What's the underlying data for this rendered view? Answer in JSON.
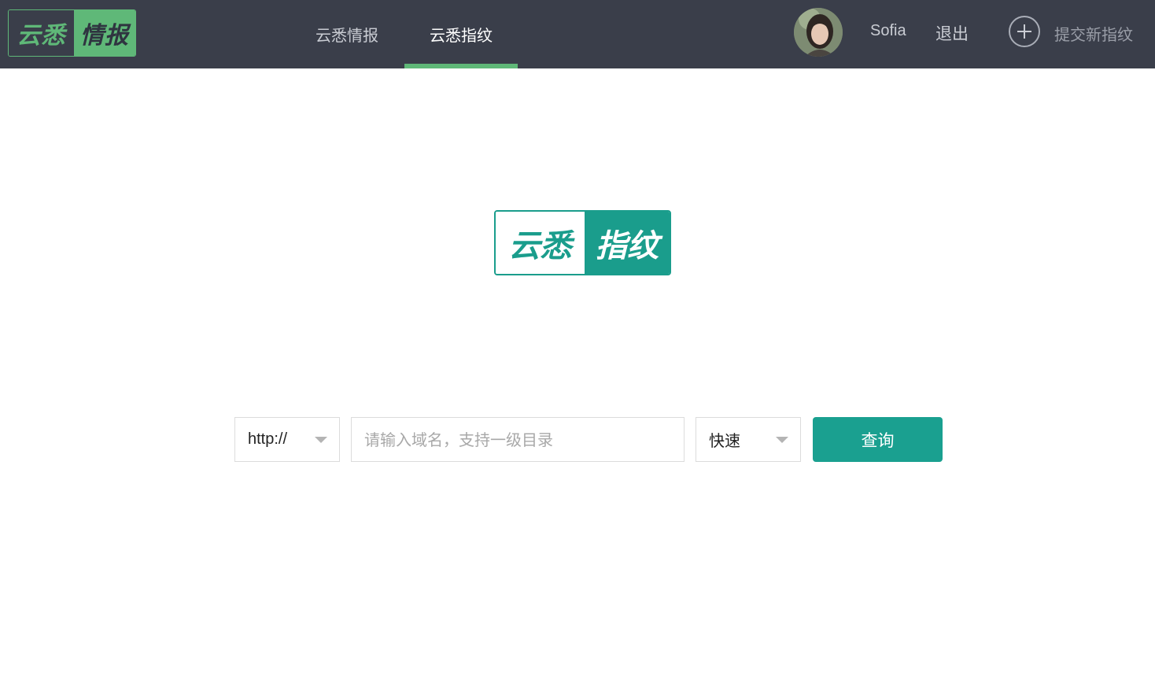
{
  "header": {
    "logo": {
      "left": "云悉",
      "right": "情报"
    },
    "tabs": [
      {
        "label": "云悉情报",
        "active": false
      },
      {
        "label": "云悉指纹",
        "active": true
      }
    ],
    "user": {
      "name": "Sofia"
    },
    "logout_label": "退出",
    "submit_label": "提交新指纹"
  },
  "main": {
    "logo": {
      "left": "云悉",
      "right": "指纹"
    },
    "search": {
      "protocol": "http://",
      "placeholder": "请输入域名，支持一级目录",
      "mode": "快速",
      "button_label": "查询"
    }
  },
  "colors": {
    "header_bg": "#3a3e4a",
    "accent_green": "#5fb878",
    "teal": "#1aa090"
  },
  "icons": {
    "add": "plus-circle-icon",
    "dropdown": "caret-down-icon"
  }
}
